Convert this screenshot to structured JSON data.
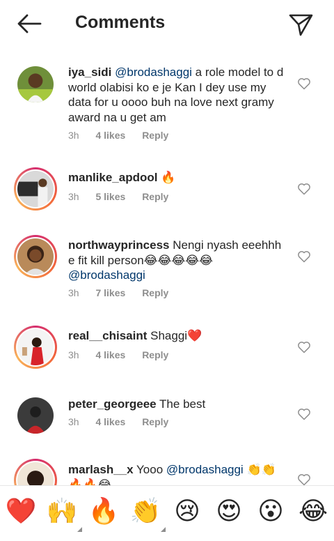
{
  "header": {
    "title": "Comments"
  },
  "comments": [
    {
      "username": "iya_sidi",
      "mention": "@brodashaggi",
      "text": " a role model to d world olabisi ko e je Kan I dey use my data for u oooo buh na love next gramy award na u get am",
      "time": "3h",
      "likes": "4 likes",
      "reply": "Reply"
    },
    {
      "username": "manlike_apdool",
      "mention": "",
      "text": "🔥",
      "time": "3h",
      "likes": "5 likes",
      "reply": "Reply"
    },
    {
      "username": "northwayprincess",
      "mention": "",
      "text": "Nengi nyash eeehhh e fit kill person😂😂😂😂😂",
      "mention_after": "@brodashaggi",
      "time": "3h",
      "likes": "7 likes",
      "reply": "Reply"
    },
    {
      "username": "real__chisaint",
      "mention": "",
      "text": "Shaggi❤️",
      "time": "3h",
      "likes": "4 likes",
      "reply": "Reply"
    },
    {
      "username": "peter_georgeee",
      "mention": "",
      "text": "The best",
      "time": "3h",
      "likes": "4 likes",
      "reply": "Reply"
    },
    {
      "username": "marlash__x",
      "mention": "",
      "text": "Yooo ",
      "mention_after": "@brodashaggi",
      "tail": " 👏👏🔥🔥😂",
      "time": "",
      "likes": "",
      "reply": ""
    }
  ],
  "reactions": [
    "❤️",
    "🙌",
    "🔥",
    "👏",
    "😢",
    "😍",
    "😮",
    "😂"
  ],
  "icons": {
    "back": "arrow-left-icon",
    "send": "paper-plane-icon",
    "like": "heart-outline-icon"
  },
  "colors": {
    "mention": "#00376b",
    "meta": "#8e8e8e",
    "text": "#262626"
  }
}
